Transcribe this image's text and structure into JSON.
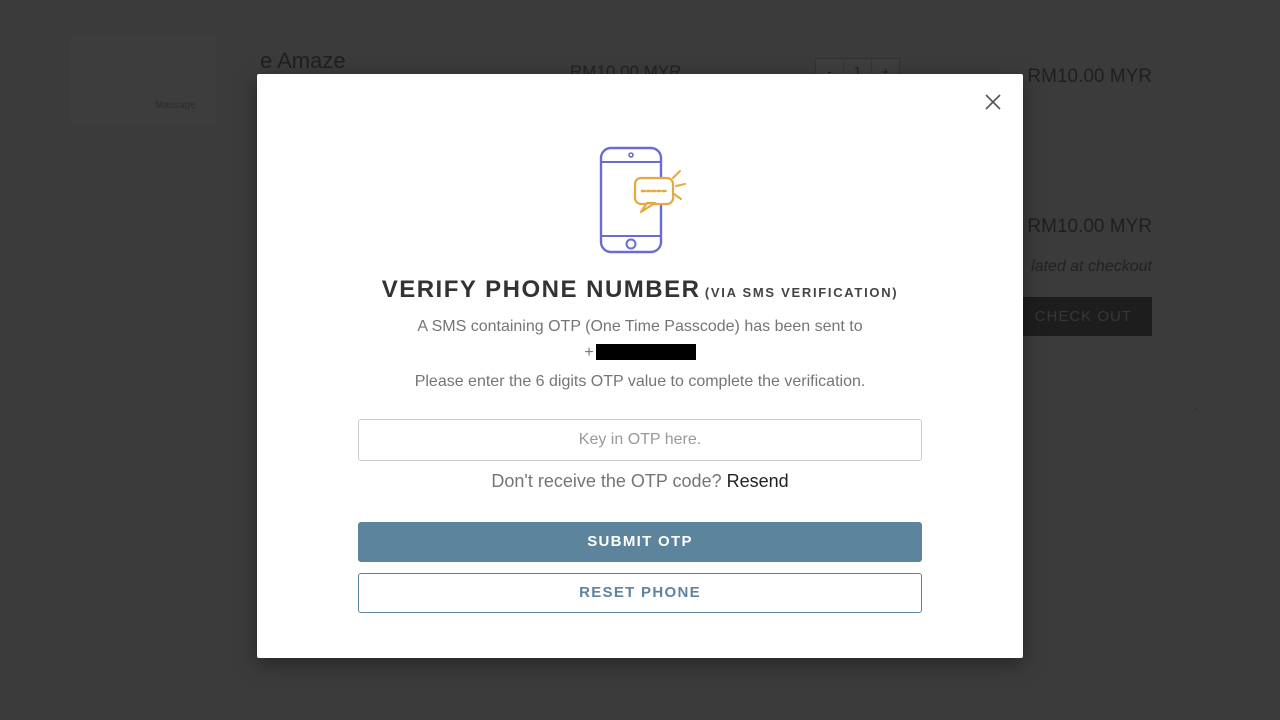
{
  "background": {
    "product_title_fragment": "e Amaze",
    "thumb_label": "Massage",
    "price_top_fragment": "RM10.00 MYR",
    "qty_minus": "-",
    "qty_value": "1",
    "qty_plus": "+",
    "line_price": "RM10.00 MYR",
    "subtotal_price": "RM10.00 MYR",
    "tax_note_fragment": "lated at checkout",
    "checkout_label": "CHECK OUT",
    "footer_note_dot": "."
  },
  "modal": {
    "close_aria": "Close",
    "heading_main": "VERIFY PHONE NUMBER",
    "heading_sub": "(VIA SMS VERIFICATION)",
    "desc_line1": "A SMS containing OTP (One Time Passcode) has been sent to",
    "masked_prefix": "+",
    "desc_line2": "Please enter the 6 digits OTP value to complete the verification.",
    "otp_placeholder": "Key in OTP here.",
    "resend_prompt": "Don't receive the OTP code? ",
    "resend_link": "Resend",
    "submit_label": "SUBMIT OTP",
    "reset_label": "RESET PHONE"
  },
  "colors": {
    "accent": "#5c849d",
    "illustration_stroke": "#6b6bd6",
    "illustration_accent": "#e9a73f"
  }
}
